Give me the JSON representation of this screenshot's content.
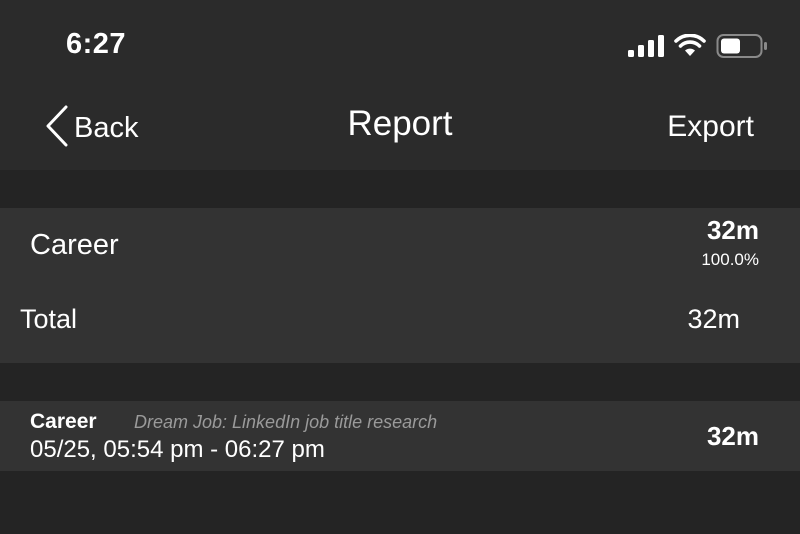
{
  "status_bar": {
    "time": "6:27",
    "icons": [
      "cellular-signal-icon",
      "wifi-icon",
      "battery-icon"
    ]
  },
  "nav": {
    "back_label": "Back",
    "title": "Report",
    "export_label": "Export"
  },
  "summary": {
    "category": "Career",
    "duration": "32m",
    "percent": "100.0%",
    "total_label": "Total",
    "total_value": "32m"
  },
  "entries": [
    {
      "category": "Career",
      "note": "Dream Job: LinkedIn job title research",
      "range": "05/25, 05:54 pm - 06:27 pm",
      "duration": "32m"
    }
  ],
  "colors": {
    "background": "#242424",
    "bar": "#2b2b2b",
    "row": "#333333",
    "text": "#ffffff",
    "note": "#9a9a9a"
  }
}
